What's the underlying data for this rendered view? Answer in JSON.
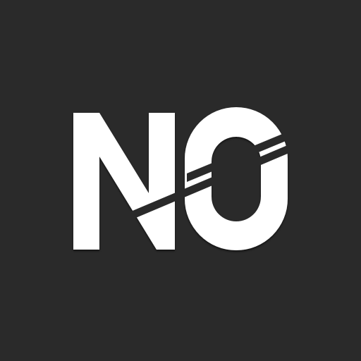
{
  "logo": {
    "text": "NO",
    "icon": "no-logo-icon",
    "colors": {
      "background": "#2a2a2a",
      "letter": "#ffffff",
      "shadow": "#000000"
    }
  }
}
